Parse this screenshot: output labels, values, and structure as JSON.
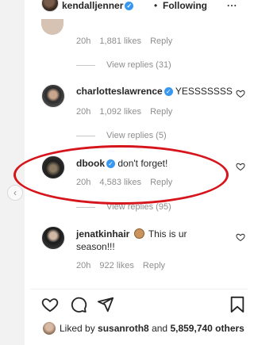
{
  "header": {
    "username": "kendalljenner",
    "separator": "•",
    "follow_label": "Following",
    "more_label": "..."
  },
  "nav": {
    "prev_label": "‹"
  },
  "comments": [
    {
      "time": "20h",
      "likes": "1,881 likes",
      "reply": "Reply",
      "view_replies": "View replies (31)"
    },
    {
      "username": "charlotteslawrence",
      "text": "YESSSSSSS",
      "time": "20h",
      "likes": "1,092 likes",
      "reply": "Reply",
      "view_replies": "View replies (5)"
    },
    {
      "username": "dbook",
      "text": "don't forget!",
      "time": "20h",
      "likes": "4,583 likes",
      "reply": "Reply",
      "view_replies": "View replies (95)"
    },
    {
      "username": "jenatkinhair",
      "text": "This is ur",
      "text2": "season!!!",
      "time": "20h",
      "likes": "922 likes",
      "reply": "Reply"
    }
  ],
  "likes": {
    "prefix": "Liked by",
    "user": "susanroth8",
    "and": "and",
    "others": "5,859,740 others"
  },
  "colors": {
    "highlight": "#d6141b",
    "verified": "#3897f0",
    "muted": "#8e8e8e",
    "text": "#262626"
  },
  "icons": [
    "heart-icon",
    "comment-icon",
    "share-icon",
    "bookmark-icon",
    "verified-badge-icon",
    "chevron-left-icon"
  ]
}
